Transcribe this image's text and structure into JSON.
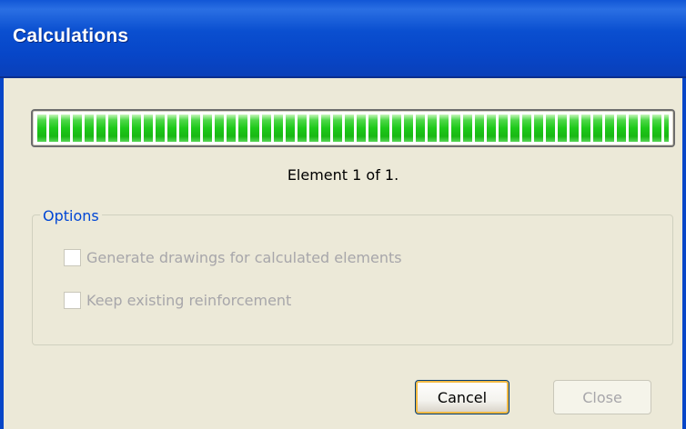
{
  "window": {
    "title": "Calculations"
  },
  "progress": {
    "fraction": 1.0,
    "color": "#22c41c",
    "status_text": "Element 1 of 1."
  },
  "options": {
    "group_label": "Options",
    "items": [
      {
        "label": "Generate drawings for calculated elements",
        "checked": false,
        "enabled": false
      },
      {
        "label": "Keep existing reinforcement",
        "checked": false,
        "enabled": false
      }
    ]
  },
  "buttons": {
    "cancel": {
      "label": "Cancel",
      "enabled": true
    },
    "close": {
      "label": "Close",
      "enabled": false
    }
  }
}
